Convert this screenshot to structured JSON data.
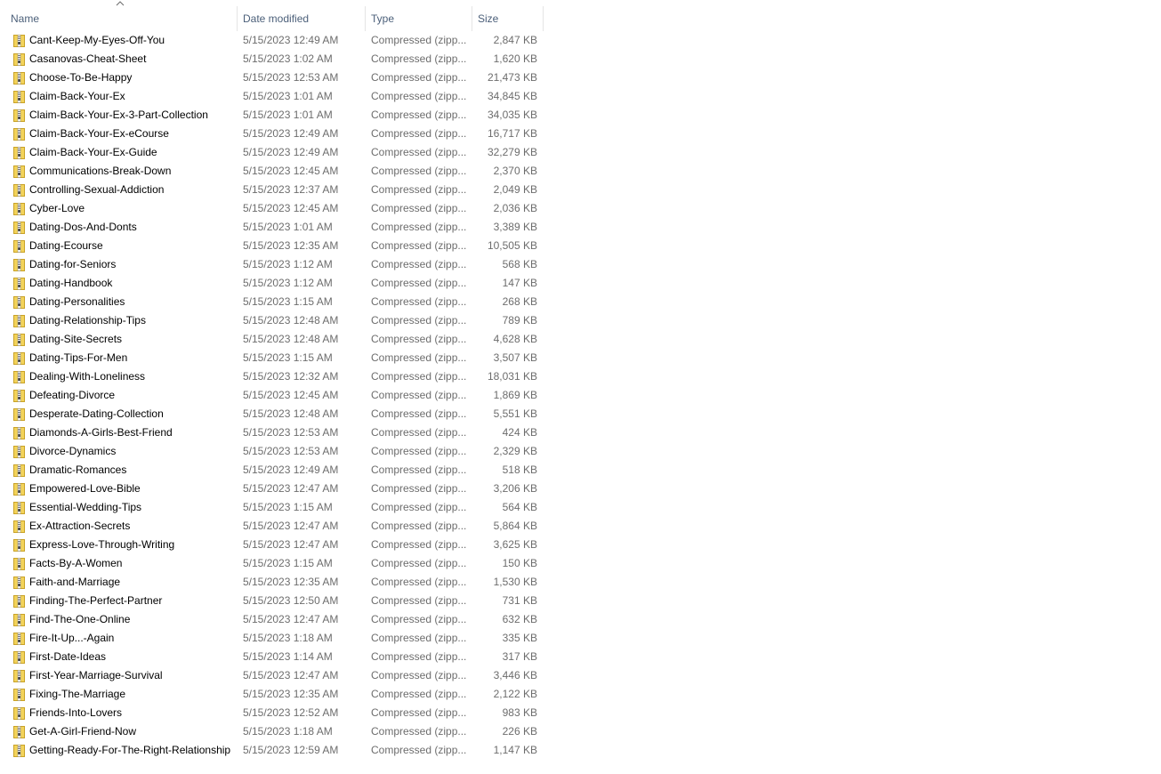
{
  "columns": {
    "name": "Name",
    "date": "Date modified",
    "type": "Type",
    "size": "Size",
    "sort_indicator": "chevron-up-icon"
  },
  "files": [
    {
      "name": "Cant-Keep-My-Eyes-Off-You",
      "date": "5/15/2023 12:49 AM",
      "type": "Compressed (zipp...",
      "size": "2,847 KB"
    },
    {
      "name": "Casanovas-Cheat-Sheet",
      "date": "5/15/2023 1:02 AM",
      "type": "Compressed (zipp...",
      "size": "1,620 KB"
    },
    {
      "name": "Choose-To-Be-Happy",
      "date": "5/15/2023 12:53 AM",
      "type": "Compressed (zipp...",
      "size": "21,473 KB"
    },
    {
      "name": "Claim-Back-Your-Ex",
      "date": "5/15/2023 1:01 AM",
      "type": "Compressed (zipp...",
      "size": "34,845 KB"
    },
    {
      "name": "Claim-Back-Your-Ex-3-Part-Collection",
      "date": "5/15/2023 1:01 AM",
      "type": "Compressed (zipp...",
      "size": "34,035 KB"
    },
    {
      "name": "Claim-Back-Your-Ex-eCourse",
      "date": "5/15/2023 12:49 AM",
      "type": "Compressed (zipp...",
      "size": "16,717 KB"
    },
    {
      "name": "Claim-Back-Your-Ex-Guide",
      "date": "5/15/2023 12:49 AM",
      "type": "Compressed (zipp...",
      "size": "32,279 KB"
    },
    {
      "name": "Communications-Break-Down",
      "date": "5/15/2023 12:45 AM",
      "type": "Compressed (zipp...",
      "size": "2,370 KB"
    },
    {
      "name": "Controlling-Sexual-Addiction",
      "date": "5/15/2023 12:37 AM",
      "type": "Compressed (zipp...",
      "size": "2,049 KB"
    },
    {
      "name": "Cyber-Love",
      "date": "5/15/2023 12:45 AM",
      "type": "Compressed (zipp...",
      "size": "2,036 KB"
    },
    {
      "name": "Dating-Dos-And-Donts",
      "date": "5/15/2023 1:01 AM",
      "type": "Compressed (zipp...",
      "size": "3,389 KB"
    },
    {
      "name": "Dating-Ecourse",
      "date": "5/15/2023 12:35 AM",
      "type": "Compressed (zipp...",
      "size": "10,505 KB"
    },
    {
      "name": "Dating-for-Seniors",
      "date": "5/15/2023 1:12 AM",
      "type": "Compressed (zipp...",
      "size": "568 KB"
    },
    {
      "name": "Dating-Handbook",
      "date": "5/15/2023 1:12 AM",
      "type": "Compressed (zipp...",
      "size": "147 KB"
    },
    {
      "name": "Dating-Personalities",
      "date": "5/15/2023 1:15 AM",
      "type": "Compressed (zipp...",
      "size": "268 KB"
    },
    {
      "name": "Dating-Relationship-Tips",
      "date": "5/15/2023 12:48 AM",
      "type": "Compressed (zipp...",
      "size": "789 KB"
    },
    {
      "name": "Dating-Site-Secrets",
      "date": "5/15/2023 12:48 AM",
      "type": "Compressed (zipp...",
      "size": "4,628 KB"
    },
    {
      "name": "Dating-Tips-For-Men",
      "date": "5/15/2023 1:15 AM",
      "type": "Compressed (zipp...",
      "size": "3,507 KB"
    },
    {
      "name": "Dealing-With-Loneliness",
      "date": "5/15/2023 12:32 AM",
      "type": "Compressed (zipp...",
      "size": "18,031 KB"
    },
    {
      "name": "Defeating-Divorce",
      "date": "5/15/2023 12:45 AM",
      "type": "Compressed (zipp...",
      "size": "1,869 KB"
    },
    {
      "name": "Desperate-Dating-Collection",
      "date": "5/15/2023 12:48 AM",
      "type": "Compressed (zipp...",
      "size": "5,551 KB"
    },
    {
      "name": "Diamonds-A-Girls-Best-Friend",
      "date": "5/15/2023 12:53 AM",
      "type": "Compressed (zipp...",
      "size": "424 KB"
    },
    {
      "name": "Divorce-Dynamics",
      "date": "5/15/2023 12:53 AM",
      "type": "Compressed (zipp...",
      "size": "2,329 KB"
    },
    {
      "name": "Dramatic-Romances",
      "date": "5/15/2023 12:49 AM",
      "type": "Compressed (zipp...",
      "size": "518 KB"
    },
    {
      "name": "Empowered-Love-Bible",
      "date": "5/15/2023 12:47 AM",
      "type": "Compressed (zipp...",
      "size": "3,206 KB"
    },
    {
      "name": "Essential-Wedding-Tips",
      "date": "5/15/2023 1:15 AM",
      "type": "Compressed (zipp...",
      "size": "564 KB"
    },
    {
      "name": "Ex-Attraction-Secrets",
      "date": "5/15/2023 12:47 AM",
      "type": "Compressed (zipp...",
      "size": "5,864 KB"
    },
    {
      "name": "Express-Love-Through-Writing",
      "date": "5/15/2023 12:47 AM",
      "type": "Compressed (zipp...",
      "size": "3,625 KB"
    },
    {
      "name": "Facts-By-A-Women",
      "date": "5/15/2023 1:15 AM",
      "type": "Compressed (zipp...",
      "size": "150 KB"
    },
    {
      "name": "Faith-and-Marriage",
      "date": "5/15/2023 12:35 AM",
      "type": "Compressed (zipp...",
      "size": "1,530 KB"
    },
    {
      "name": "Finding-The-Perfect-Partner",
      "date": "5/15/2023 12:50 AM",
      "type": "Compressed (zipp...",
      "size": "731 KB"
    },
    {
      "name": "Find-The-One-Online",
      "date": "5/15/2023 12:47 AM",
      "type": "Compressed (zipp...",
      "size": "632 KB"
    },
    {
      "name": "Fire-It-Up...-Again",
      "date": "5/15/2023 1:18 AM",
      "type": "Compressed (zipp...",
      "size": "335 KB"
    },
    {
      "name": "First-Date-Ideas",
      "date": "5/15/2023 1:14 AM",
      "type": "Compressed (zipp...",
      "size": "317 KB"
    },
    {
      "name": "First-Year-Marriage-Survival",
      "date": "5/15/2023 12:47 AM",
      "type": "Compressed (zipp...",
      "size": "3,446 KB"
    },
    {
      "name": "Fixing-The-Marriage",
      "date": "5/15/2023 12:35 AM",
      "type": "Compressed (zipp...",
      "size": "2,122 KB"
    },
    {
      "name": "Friends-Into-Lovers",
      "date": "5/15/2023 12:52 AM",
      "type": "Compressed (zipp...",
      "size": "983 KB"
    },
    {
      "name": "Get-A-Girl-Friend-Now",
      "date": "5/15/2023 1:18 AM",
      "type": "Compressed (zipp...",
      "size": "226 KB"
    },
    {
      "name": "Getting-Ready-For-The-Right-Relationship",
      "date": "5/15/2023 12:59 AM",
      "type": "Compressed (zipp...",
      "size": "1,147 KB"
    }
  ],
  "icons": {
    "file_icon": "zip-folder-icon",
    "zipper_color": "#e8c040",
    "folder_color": "#f3d35a"
  }
}
